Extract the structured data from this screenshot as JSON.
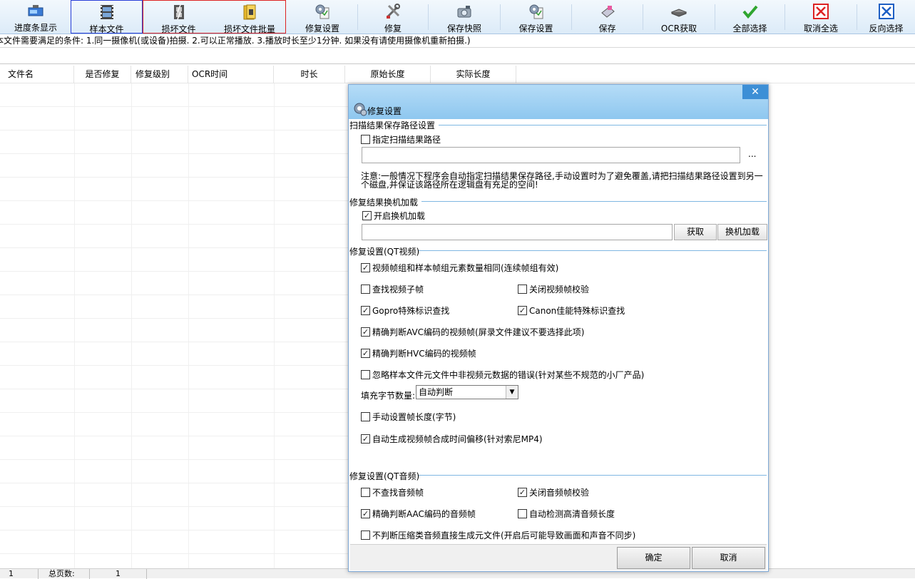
{
  "toolbar": {
    "items": [
      {
        "label": "进度条显示",
        "icon": "progress-display-icon"
      },
      {
        "label": "样本文件",
        "icon": "sample-film-icon"
      },
      {
        "label": "损坏文件",
        "icon": "damaged-film-icon"
      },
      {
        "label": "损坏文件批量",
        "icon": "batch-folder-icon"
      },
      {
        "label": "修复设置",
        "icon": "gear-doc-icon"
      },
      {
        "label": "修复",
        "icon": "tools-icon"
      },
      {
        "label": "保存快照",
        "icon": "camera-icon"
      },
      {
        "label": "保存设置",
        "icon": "gear-doc-icon"
      },
      {
        "label": "保存",
        "icon": "disk-save-icon"
      },
      {
        "label": "OCR获取",
        "icon": "ocr-scanner-icon"
      },
      {
        "label": "全部选择",
        "icon": "check-all-icon"
      },
      {
        "label": "取消全选",
        "icon": "uncheck-all-icon"
      },
      {
        "label": "反向选择",
        "icon": "invert-selection-icon"
      }
    ],
    "accent_colors": {
      "sample": "#2a3fd8",
      "damaged": "#d22222"
    }
  },
  "notice": "本文件需要满足的条件: 1.同一摄像机(或设备)拍摄. 2.可以正常播放. 3.播放时长至少1分钟. 如果没有请使用摄像机重新拍摄.)",
  "table": {
    "columns": [
      "文件名",
      "是否修复",
      "修复级别",
      "OCR时间",
      "时长",
      "原始长度",
      "实际长度"
    ]
  },
  "statusbar": {
    "page": "1",
    "total_pages_label": "总页数:",
    "total_pages": "1"
  },
  "dialog": {
    "close": "✕",
    "title": "修复设置",
    "section_path": {
      "title": "扫描结果保存路径设置",
      "checkbox": {
        "label": "指定扫描结果路径",
        "checked": false
      },
      "path_value": "",
      "browse": "...",
      "note": "注意:一般情况下程序会自动指定扫描结果保存路径,手动设置时为了避免覆盖,请把扫描结果路径设置到另一个磁盘,并保证该路径所在逻辑盘有充足的空间!"
    },
    "section_load": {
      "title": "修复结果换机加载",
      "checkbox": {
        "label": "开启换机加载",
        "checked": true
      },
      "path_value": "",
      "get_button": "获取",
      "load_button": "换机加载"
    },
    "section_video": {
      "title": "修复设置(QT视频)",
      "options": [
        {
          "label": "视频帧组和样本帧组元素数量相同(连续帧组有效)",
          "checked": true
        },
        {
          "label": "查找视频子帧",
          "checked": false
        },
        {
          "label": "关闭视频帧校验",
          "checked": false
        },
        {
          "label": "Gopro特殊标识查找",
          "checked": true
        },
        {
          "label": "Canon佳能特殊标识查找",
          "checked": true
        },
        {
          "label": "精确判断AVC编码的视频帧(屏录文件建议不要选择此项)",
          "checked": true
        },
        {
          "label": "精确判断HVC编码的视频帧",
          "checked": true
        },
        {
          "label": "忽略样本文件元文件中非视频元数据的错误(针对某些不规范的小厂产品)",
          "checked": false
        },
        {
          "label": "手动设置帧长度(字节)",
          "checked": false
        },
        {
          "label": "自动生成视频帧合成时间偏移(针对索尼MP4)",
          "checked": true
        }
      ],
      "fill_label": "填充字节数量:",
      "fill_value": "自动判断"
    },
    "section_audio": {
      "title": "修复设置(QT音频)",
      "options": [
        {
          "label": "不查找音频帧",
          "checked": false
        },
        {
          "label": "关闭音频帧校验",
          "checked": true
        },
        {
          "label": "精确判断AAC编码的音频帧",
          "checked": true
        },
        {
          "label": "自动检测高清音频长度",
          "checked": false
        },
        {
          "label": "不判断压缩类音频直接生成元文件(开启后可能导致画面和声音不同步)",
          "checked": false
        }
      ]
    },
    "ok": "确定",
    "cancel": "取消"
  }
}
